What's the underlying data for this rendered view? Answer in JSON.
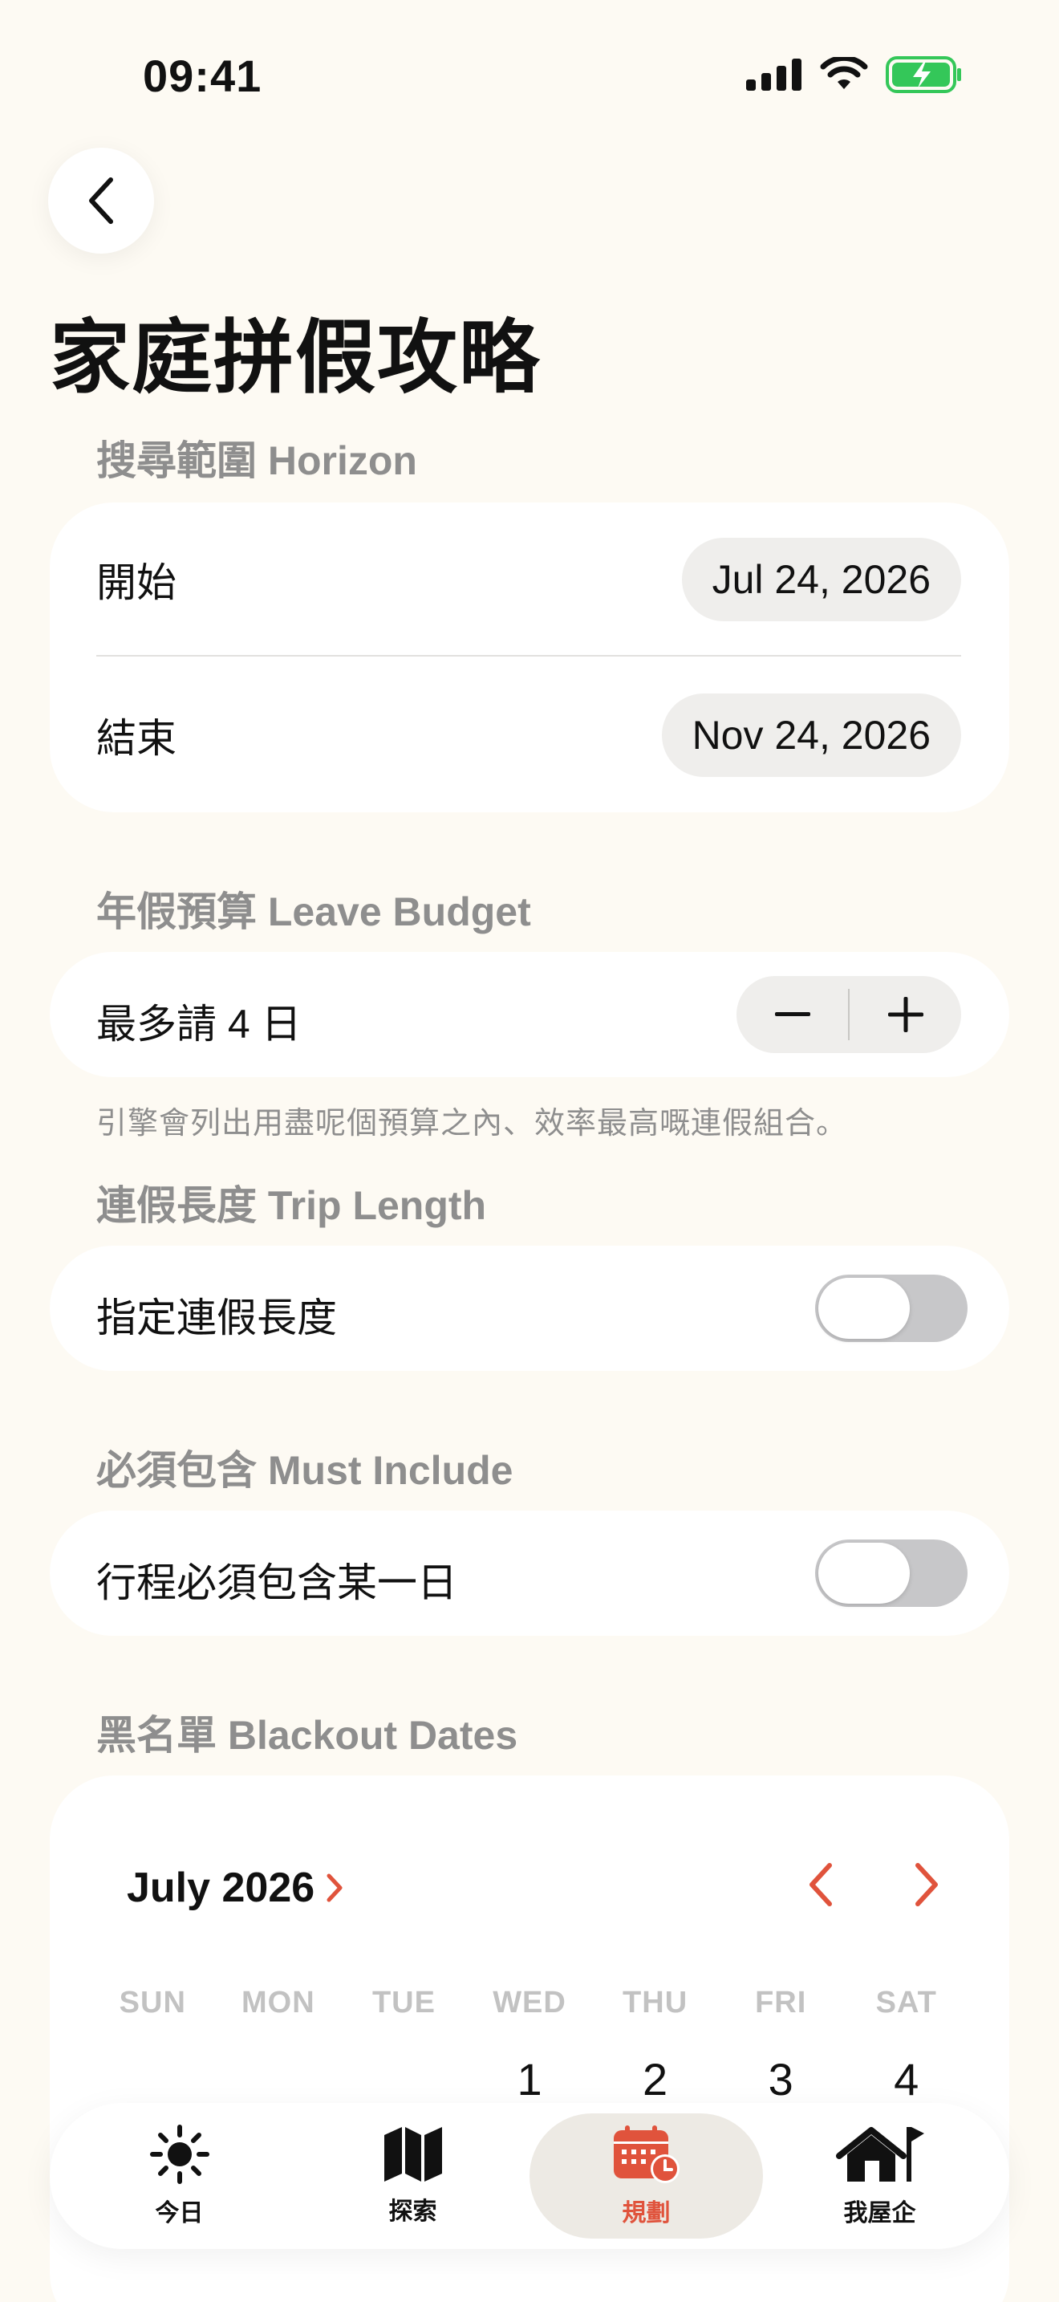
{
  "status": {
    "time": "09:41"
  },
  "title": "家庭拼假攻略",
  "horizon": {
    "label": "搜尋範圍 Horizon",
    "start_label": "開始",
    "start_value": "Jul 24, 2026",
    "end_label": "結束",
    "end_value": "Nov 24, 2026"
  },
  "budget": {
    "label": "年假預算 Leave Budget",
    "text": "最多請 4 日",
    "minus": "−",
    "plus": "+",
    "hint": "引擎會列出用盡呢個預算之內、效率最高嘅連假組合。"
  },
  "trip_length": {
    "label": "連假長度 Trip Length",
    "row": "指定連假長度",
    "enabled": false
  },
  "must_include": {
    "label": "必須包含 Must Include",
    "row": "行程必須包含某一日",
    "enabled": false
  },
  "blackout": {
    "label": "黑名單 Blackout Dates",
    "month": "July 2026",
    "weekdays": [
      "SUN",
      "MON",
      "TUE",
      "WED",
      "THU",
      "FRI",
      "SAT"
    ],
    "first_week": [
      "",
      "",
      "",
      "1",
      "2",
      "3",
      "4"
    ]
  },
  "tabs": [
    {
      "label": "今日",
      "icon": "sun-icon"
    },
    {
      "label": "探索",
      "icon": "map-icon"
    },
    {
      "label": "規劃",
      "icon": "calendar-clock-icon",
      "active": true
    },
    {
      "label": "我屋企",
      "icon": "home-flag-icon"
    }
  ],
  "colors": {
    "accent": "#E0533C",
    "background": "#FDFAF3",
    "battery": "#34C759"
  }
}
